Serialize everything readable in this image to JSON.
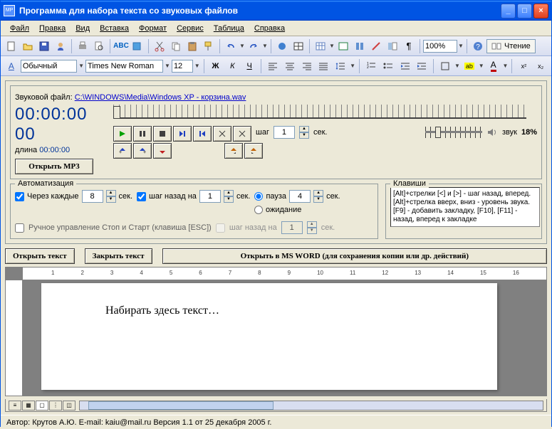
{
  "window": {
    "title": "Программа для набора текста со звуковых файлов",
    "icon_text": "MP"
  },
  "menu": [
    "Файл",
    "Правка",
    "Вид",
    "Вставка",
    "Формат",
    "Сервис",
    "Таблица",
    "Справка"
  ],
  "toolbar1": {
    "zoom": "100%",
    "reading_label": "Чтение"
  },
  "format": {
    "style_label": "A",
    "style": "Обычный",
    "font": "Times New Roman",
    "size": "12",
    "bold": "Ж",
    "italic": "К",
    "underline": "Ч"
  },
  "audio": {
    "file_label": "Звуковой файл:",
    "file_path": "C:\\WINDOWS\\Media\\Windows XP - корзина.wav",
    "time": "00:00:00 00",
    "duration_label": "длина",
    "duration": "00:00:00",
    "open_mp3": "Открыть MP3",
    "step_label": "шаг",
    "step_value": "1",
    "step_sec": "сек.",
    "sound_label": "звук",
    "sound_percent": "18%"
  },
  "auto": {
    "legend": "Автоматизация",
    "every_label": "Через каждые",
    "every_value": "8",
    "every_sec": "сек.",
    "back_label": "шаг назад на",
    "back_value": "1",
    "back_sec": "сек.",
    "pause_label": "пауза",
    "pause_value": "4",
    "pause_sec": "сек.",
    "wait_label": "ожидание",
    "hints_legend": "Клавиши",
    "hints": "[Alt]+стрелки [<] и [>] - шаг назад, вперед.\n[Alt]+стрелка вверх, вниз - уровень звука.\n[F9] - добавить закладку, [F10], [F11] - назад, вперед к закладке",
    "manual_label": "Ручное управление Стоп и Старт (клавиша [ESC])",
    "back2_label": "шаг назад на",
    "back2_value": "1",
    "back2_sec": "сек."
  },
  "buttons": {
    "open_text": "Открыть текст",
    "close_text": "Закрыть текст",
    "open_word": "Открыть в MS WORD (для сохранения копии или др. действий)"
  },
  "doc": {
    "placeholder": "Набирать здесь текст…"
  },
  "status": {
    "text": "Автор: Крутов А.Ю.  E-mail: kaiu@mail.ru  Версия 1.1 от 25 декабря 2005 г."
  }
}
